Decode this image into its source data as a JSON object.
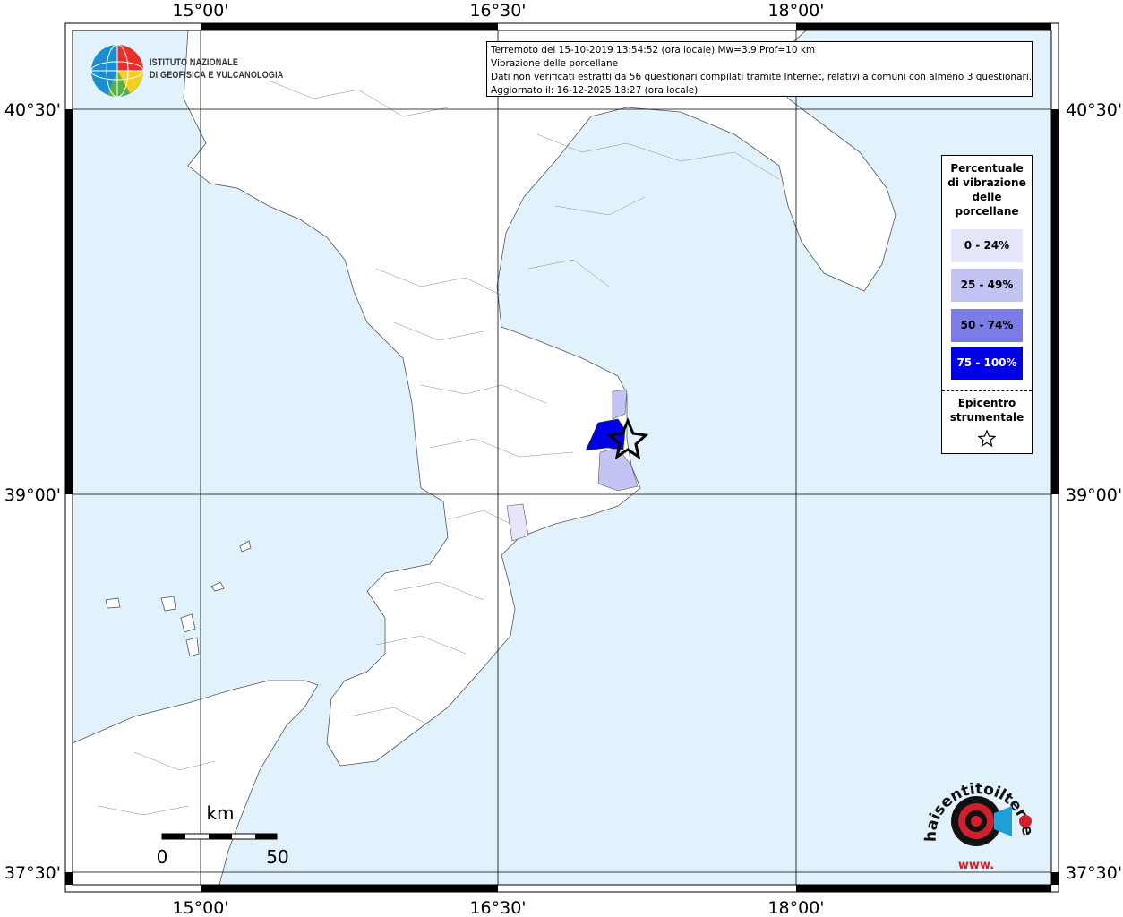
{
  "title_box": {
    "line1": "Terremoto del 15-10-2019 13:54:52 (ora locale) Mw=3.9 Prof=10 km",
    "line2": "Vibrazione delle porcellane",
    "line3": "Dati non verificati estratti da 56 questionari compilati tramite Internet, relativi a comuni con almeno 3 questionari.",
    "line4": "Aggiornato il: 16-12-2025 18:27 (ora locale)"
  },
  "logo": {
    "line1": "ISTITUTO NAZIONALE",
    "line2": "DI GEOFISICA E VULCANOLOGIA"
  },
  "axes": {
    "lon_labels": [
      "15°00'",
      "16°30'",
      "18°00'"
    ],
    "lat_labels": [
      "40°30'",
      "39°00'",
      "37°30'"
    ]
  },
  "legend": {
    "title": "Percentuale di vibrazione delle porcellane",
    "title_lines": [
      "Percentuale",
      "di vibrazione",
      "delle",
      "porcellane"
    ],
    "items": [
      {
        "label": "0 - 24%",
        "color": "#e6e6fa",
        "text_color": "#000000"
      },
      {
        "label": "25 - 49%",
        "color": "#c4c4f4",
        "text_color": "#000000"
      },
      {
        "label": "50 - 74%",
        "color": "#7c7ce6",
        "text_color": "#000000"
      },
      {
        "label": "75 - 100%",
        "color": "#0000e6",
        "text_color": "#ffffff"
      }
    ],
    "epicenter_lines": [
      "Epicentro",
      "strumentale"
    ]
  },
  "scale_bar": {
    "unit": "km",
    "start": "0",
    "end": "50"
  },
  "haisentito": {
    "text": "haisentitoilterremoto.it",
    "prefix": "www."
  },
  "colors": {
    "sea": "#e2f2fd",
    "land": "#ffffff",
    "border": "#000000"
  }
}
